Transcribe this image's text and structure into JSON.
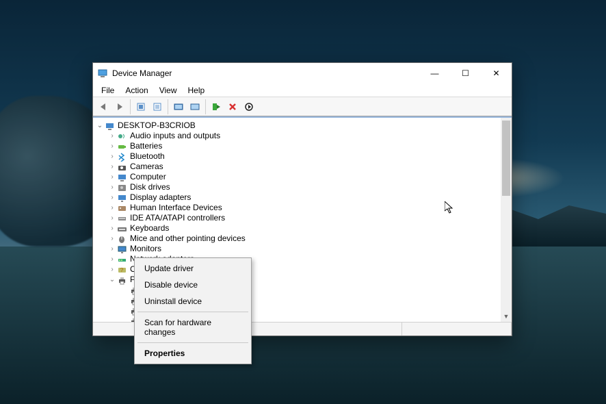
{
  "window": {
    "title": "Device Manager",
    "buttons": {
      "min": "—",
      "max": "☐",
      "close": "✕"
    }
  },
  "menubar": [
    "File",
    "Action",
    "View",
    "Help"
  ],
  "toolbar_icons": [
    "nav-back-icon",
    "nav-forward-icon",
    "sep",
    "show-hidden-icon",
    "properties-icon",
    "sep",
    "refresh-icon",
    "help-icon",
    "sep",
    "enable-device-icon",
    "disable-device-icon",
    "uninstall-icon"
  ],
  "tree": {
    "root": {
      "label": "DESKTOP-B3CRIOB",
      "expanded": true,
      "icon": "computer"
    },
    "items": [
      {
        "label": "Audio inputs and outputs",
        "icon": "audio"
      },
      {
        "label": "Batteries",
        "icon": "battery"
      },
      {
        "label": "Bluetooth",
        "icon": "bluetooth"
      },
      {
        "label": "Cameras",
        "icon": "camera"
      },
      {
        "label": "Computer",
        "icon": "computer"
      },
      {
        "label": "Disk drives",
        "icon": "disk"
      },
      {
        "label": "Display adapters",
        "icon": "display"
      },
      {
        "label": "Human Interface Devices",
        "icon": "hid"
      },
      {
        "label": "IDE ATA/ATAPI controllers",
        "icon": "ide"
      },
      {
        "label": "Keyboards",
        "icon": "keyboard"
      },
      {
        "label": "Mice and other pointing devices",
        "icon": "mouse"
      },
      {
        "label": "Monitors",
        "icon": "monitor"
      },
      {
        "label": "Network adapters",
        "icon": "network"
      },
      {
        "label": "Other devices",
        "icon": "other"
      },
      {
        "label": "Print queues",
        "icon": "printer",
        "expanded": true
      }
    ]
  },
  "contextmenu": {
    "items": [
      {
        "label": "Update driver",
        "bold": false
      },
      {
        "label": "Disable device",
        "bold": false
      },
      {
        "label": "Uninstall device",
        "bold": false
      },
      {
        "sep": true
      },
      {
        "label": "Scan for hardware changes",
        "bold": false
      },
      {
        "sep": true
      },
      {
        "label": "Properties",
        "bold": true
      }
    ]
  }
}
